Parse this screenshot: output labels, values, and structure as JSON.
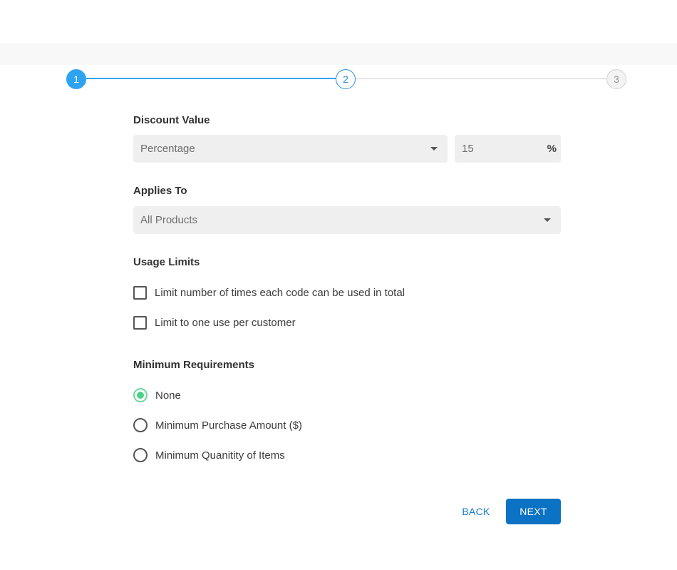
{
  "stepper": {
    "steps": [
      {
        "label": "1",
        "state": "complete"
      },
      {
        "label": "2",
        "state": "current"
      },
      {
        "label": "3",
        "state": "upcoming"
      }
    ],
    "colors": {
      "active": "#2ea3f2",
      "inactive": "#d4d4d4"
    }
  },
  "discount_value": {
    "label": "Discount Value",
    "type_select": {
      "value": "Percentage"
    },
    "amount_input": {
      "value": "15",
      "unit": "%"
    }
  },
  "applies_to": {
    "label": "Applies To",
    "select": {
      "value": "All Products"
    }
  },
  "usage_limits": {
    "label": "Usage Limits",
    "options": [
      {
        "label": "Limit number of times each code can be used in total",
        "checked": false
      },
      {
        "label": "Limit to one use per customer",
        "checked": false
      }
    ]
  },
  "minimum_requirements": {
    "label": "Minimum Requirements",
    "options": [
      {
        "label": "None",
        "selected": true
      },
      {
        "label": "Minimum Purchase Amount ($)",
        "selected": false
      },
      {
        "label": "Minimum Quanitity of Items",
        "selected": false
      }
    ],
    "selected_color": "#4cd18b"
  },
  "actions": {
    "back_label": "BACK",
    "next_label": "NEXT",
    "primary_color": "#0b72c4"
  }
}
